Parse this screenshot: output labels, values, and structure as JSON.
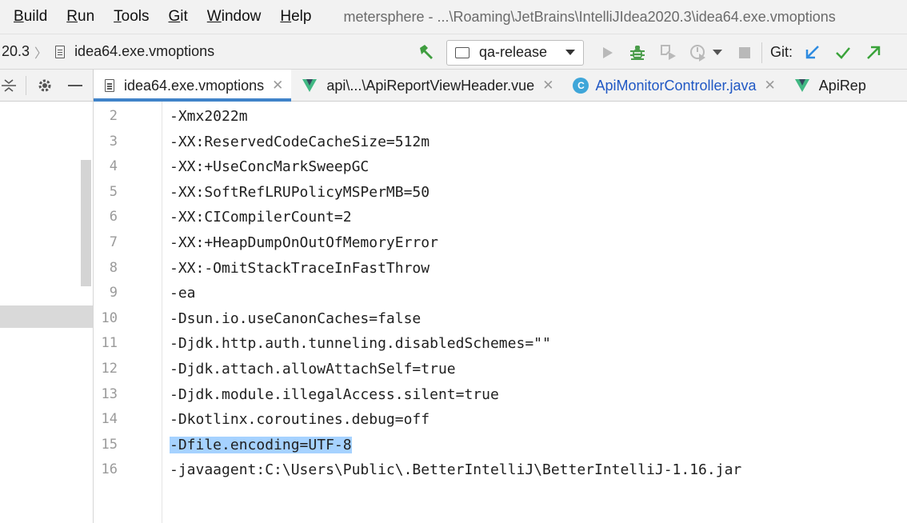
{
  "menu": {
    "items": [
      {
        "label": "Build",
        "u": "B",
        "rest": "uild"
      },
      {
        "label": "Run",
        "u": "R",
        "rest": "un"
      },
      {
        "label": "Tools",
        "u": "T",
        "rest": "ools"
      },
      {
        "label": "Git",
        "u": "G",
        "rest": "it"
      },
      {
        "label": "Window",
        "u": "W",
        "rest": "indow"
      },
      {
        "label": "Help",
        "u": "H",
        "rest": "elp"
      }
    ],
    "window_title": "metersphere - ...\\Roaming\\JetBrains\\IntelliJIdea2020.3\\idea64.exe.vmoptions"
  },
  "navbar": {
    "crumb_version": "20.3",
    "crumb_file": "idea64.exe.vmoptions",
    "run_config": "qa-release",
    "git_label": "Git:"
  },
  "tabs": [
    {
      "label": "idea64.exe.vmoptions",
      "type": "file",
      "active": true
    },
    {
      "label": "api\\...\\ApiReportViewHeader.vue",
      "type": "vue",
      "active": false
    },
    {
      "label": "ApiMonitorController.java",
      "type": "java",
      "active": false
    },
    {
      "label": "ApiRep",
      "type": "vue",
      "active": false
    }
  ],
  "editor": {
    "lines": [
      {
        "no": "2",
        "text": "-Xmx2022m"
      },
      {
        "no": "3",
        "text": "-XX:ReservedCodeCacheSize=512m"
      },
      {
        "no": "4",
        "text": "-XX:+UseConcMarkSweepGC"
      },
      {
        "no": "5",
        "text": "-XX:SoftRefLRUPolicyMSPerMB=50"
      },
      {
        "no": "6",
        "text": "-XX:CICompilerCount=2"
      },
      {
        "no": "7",
        "text": "-XX:+HeapDumpOnOutOfMemoryError"
      },
      {
        "no": "8",
        "text": "-XX:-OmitStackTraceInFastThrow"
      },
      {
        "no": "9",
        "text": "-ea"
      },
      {
        "no": "10",
        "text": "-Dsun.io.useCanonCaches=false"
      },
      {
        "no": "11",
        "text": "-Djdk.http.auth.tunneling.disabledSchemes=\"\""
      },
      {
        "no": "12",
        "text": "-Djdk.attach.allowAttachSelf=true"
      },
      {
        "no": "13",
        "text": "-Djdk.module.illegalAccess.silent=true"
      },
      {
        "no": "14",
        "text": "-Dkotlinx.coroutines.debug=off"
      },
      {
        "no": "15",
        "text": "-Dfile.encoding=UTF-8"
      },
      {
        "no": "16",
        "text": "-javaagent:C:\\Users\\Public\\.BetterIntelliJ\\BetterIntelliJ-1.16.jar"
      }
    ],
    "current_line": "15",
    "selected_line": "15"
  },
  "colors": {
    "accent": "#4083c9",
    "selection": "#a6d2ff",
    "current_line": "#fcfaed",
    "vue_green": "#41b883",
    "java_blue": "#3fa6d9",
    "build_green": "#3f9d3f",
    "git_blue": "#2e8be0",
    "git_green": "#3aa33a"
  }
}
